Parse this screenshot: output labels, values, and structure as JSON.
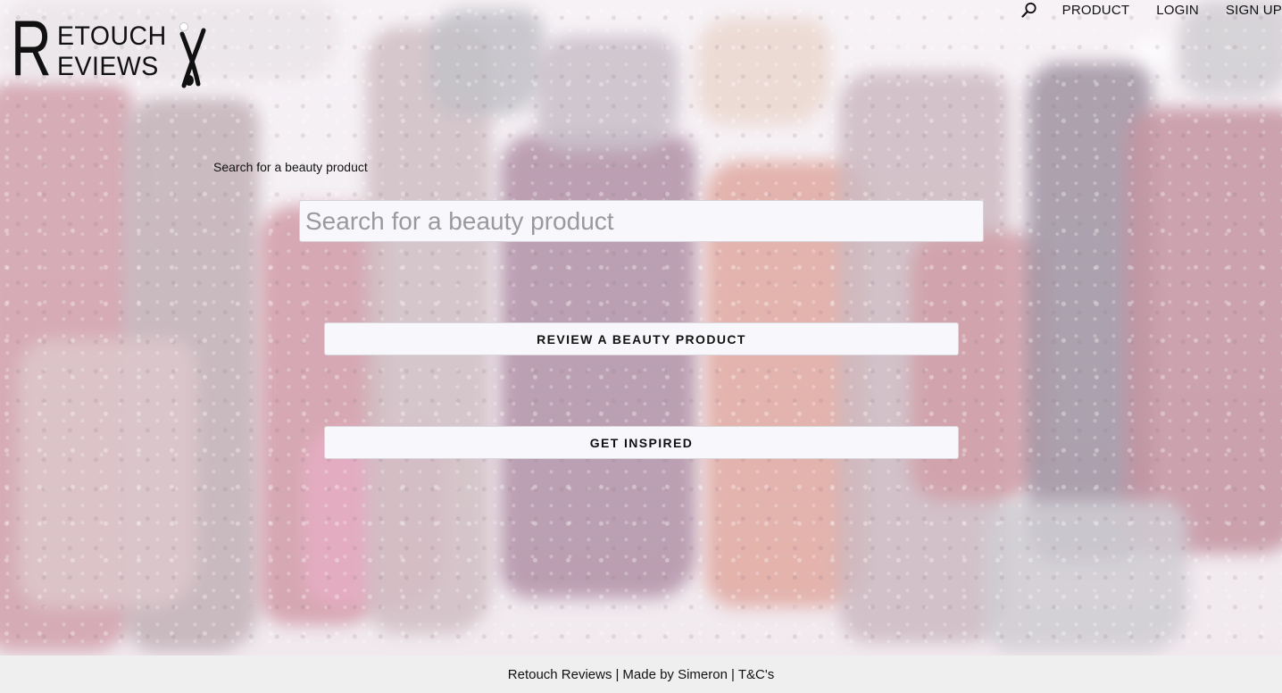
{
  "brand": {
    "logo_initial_top": "R",
    "logo_row1": "ETOUCH",
    "logo_row2": "EVIEWS",
    "logo_full": "Retouch Reviews"
  },
  "nav": {
    "search_icon": "search-icon",
    "items": [
      "PRODUCT",
      "LOGIN",
      "SIGN UP"
    ]
  },
  "main": {
    "search_label": "Search for a beauty product",
    "search_placeholder": "Search for a beauty product",
    "review_button": "REVIEW A BEAUTY PRODUCT",
    "inspire_button": "GET INSPIRED"
  },
  "footer": {
    "site": "Retouch Reviews",
    "separator": "|",
    "made_by": "Made by Simeron",
    "terms": "T&C's"
  },
  "colors": {
    "footer_bg": "#efefef",
    "field_bg": "#f8f8fc",
    "text": "#111111"
  }
}
